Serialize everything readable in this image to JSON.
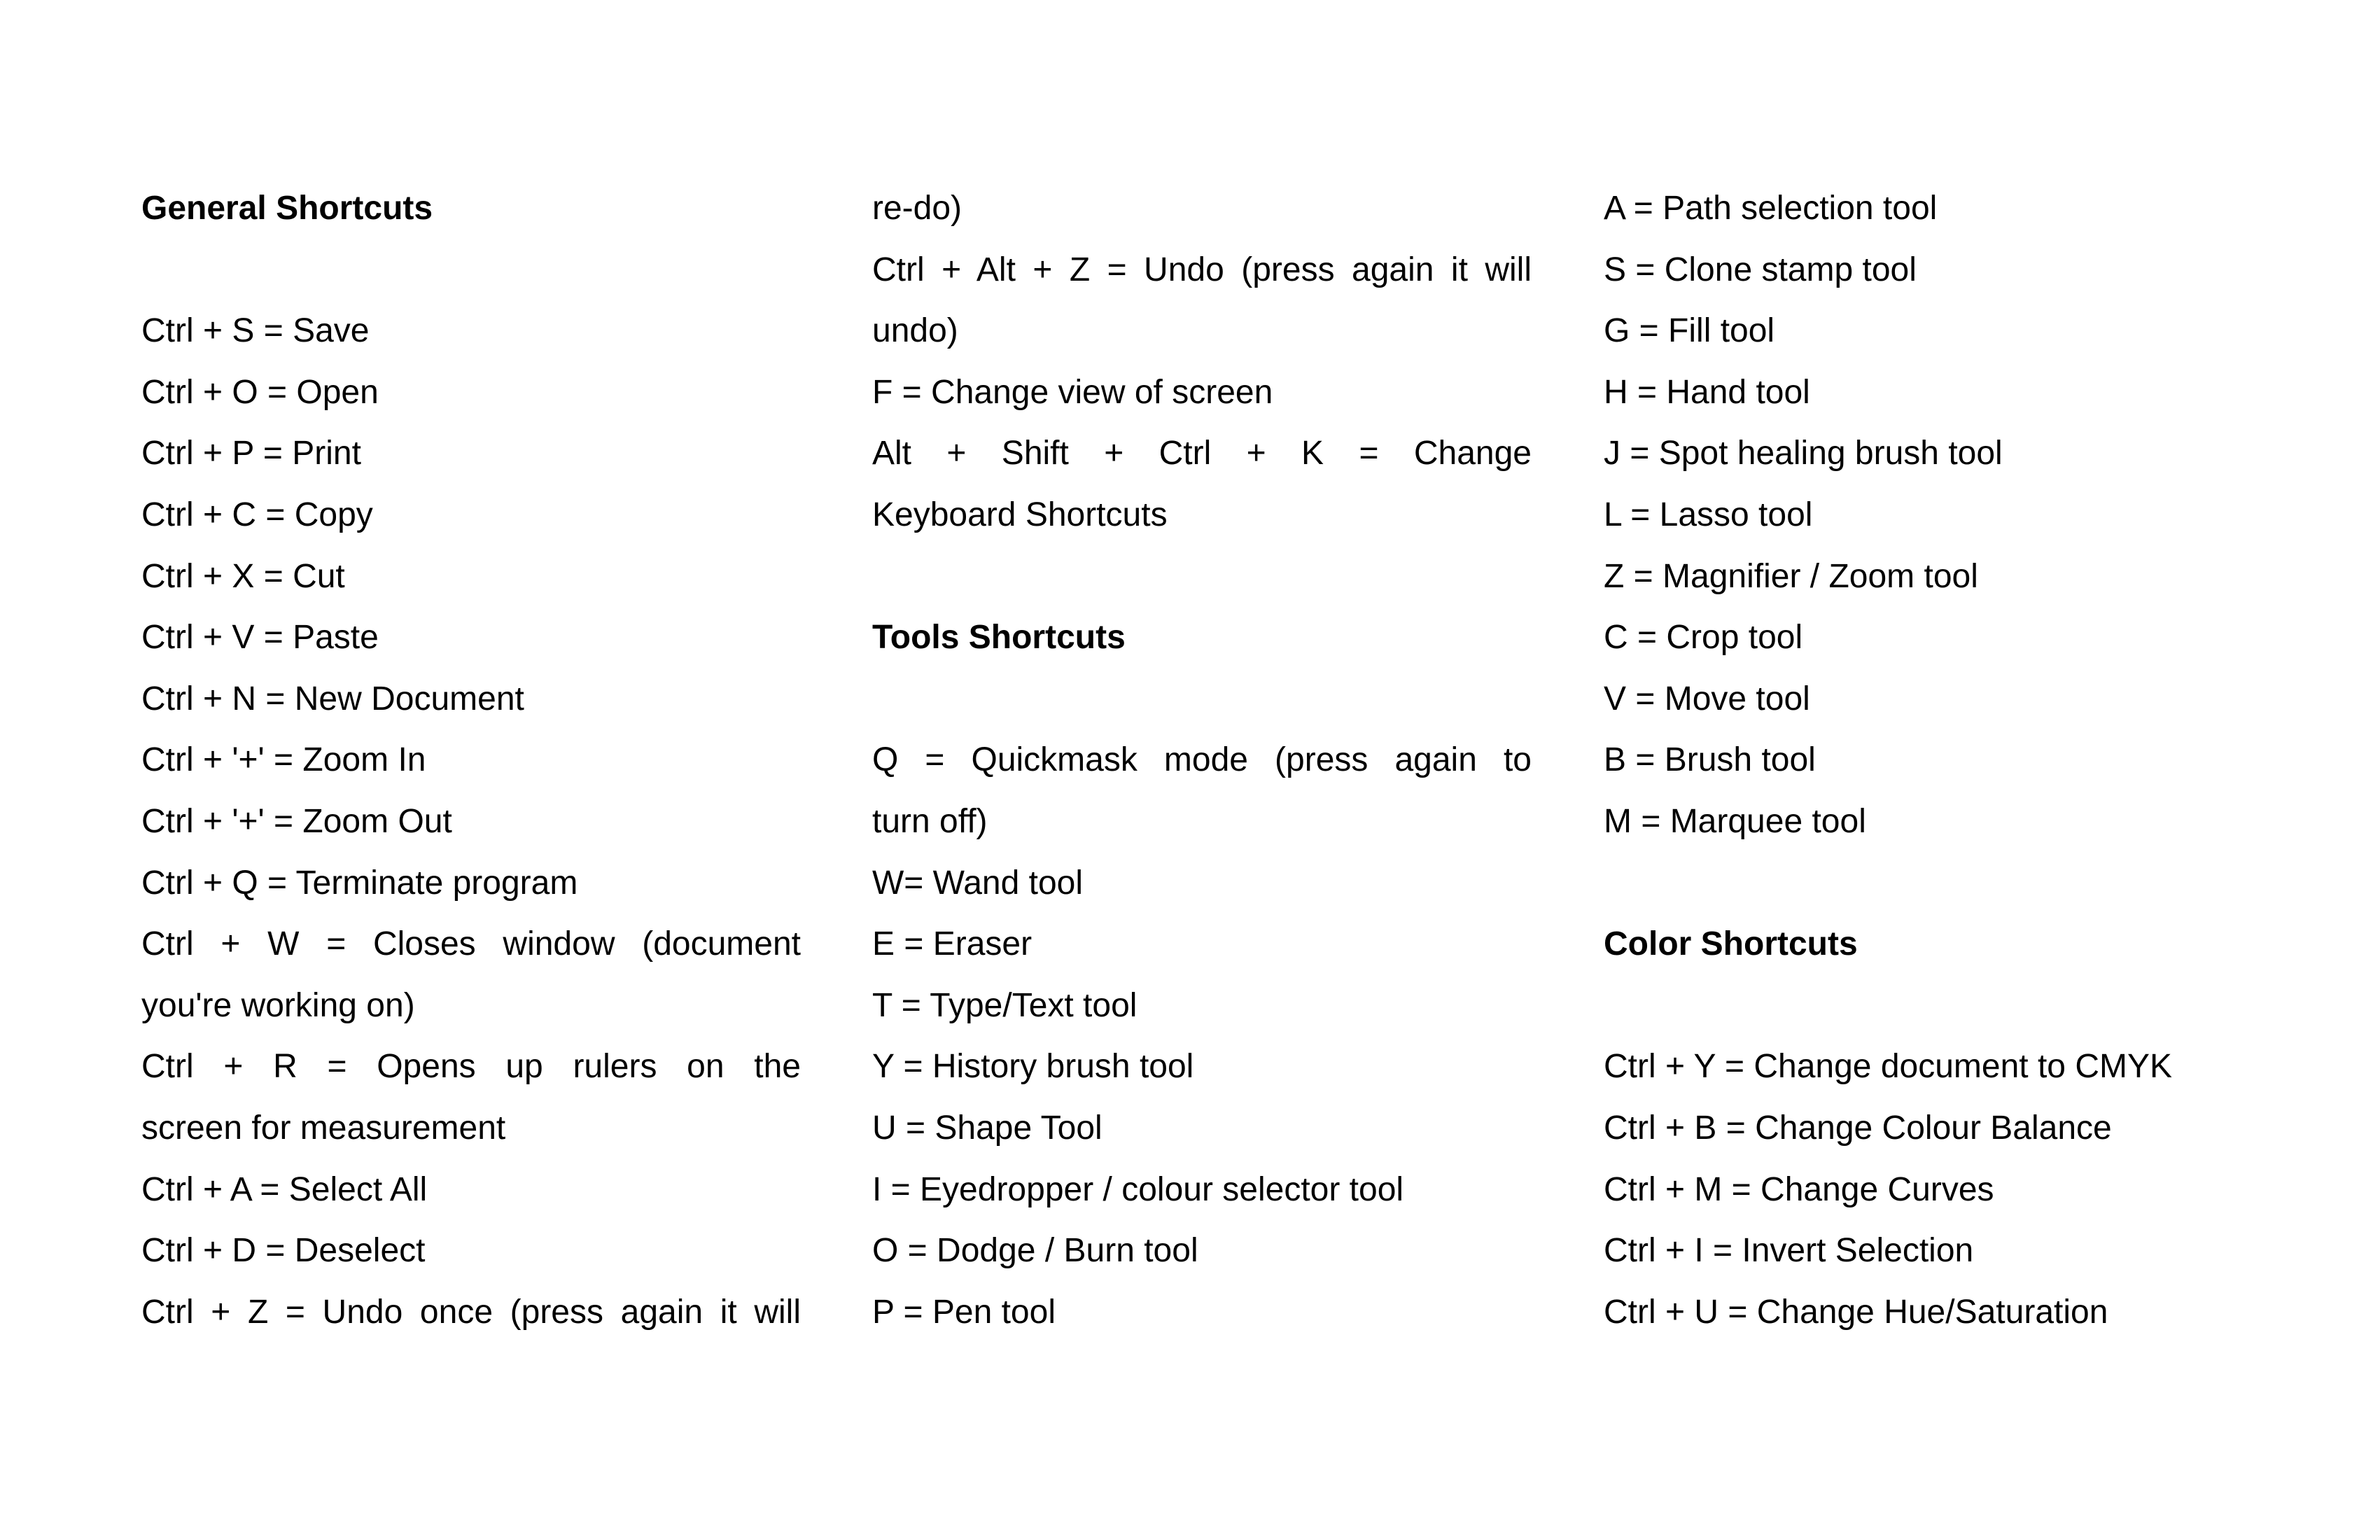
{
  "columns": [
    {
      "lines": [
        {
          "text": "General Shortcuts",
          "bold": true
        },
        {
          "text": ""
        },
        {
          "text": "Ctrl + S = Save"
        },
        {
          "text": "Ctrl + O = Open"
        },
        {
          "text": "Ctrl + P = Print"
        },
        {
          "text": "Ctrl + C = Copy"
        },
        {
          "text": "Ctrl + X = Cut"
        },
        {
          "text": "Ctrl + V = Paste"
        },
        {
          "text": "Ctrl + N = New Document"
        },
        {
          "text": "Ctrl + '+' = Zoom In"
        },
        {
          "text": "Ctrl + '+' = Zoom Out"
        },
        {
          "text": "Ctrl + Q = Terminate program"
        },
        {
          "text": "Ctrl + W = Closes window (document",
          "justify": true
        },
        {
          "text": "you're working on)"
        },
        {
          "text": "Ctrl + R = Opens up rulers on the",
          "justify": true
        },
        {
          "text": "screen for measurement"
        },
        {
          "text": "Ctrl + A = Select All"
        },
        {
          "text": "Ctrl + D = Deselect"
        },
        {
          "text": "Ctrl + Z = Undo once (press again it will",
          "justify": true
        }
      ]
    },
    {
      "lines": [
        {
          "text": "re-do)"
        },
        {
          "text": "Ctrl + Alt + Z = Undo (press again it will",
          "justify": true
        },
        {
          "text": "undo)"
        },
        {
          "text": "F = Change view of screen"
        },
        {
          "text": "Alt + Shift + Ctrl + K = Change",
          "justify": true
        },
        {
          "text": "Keyboard Shortcuts"
        },
        {
          "text": ""
        },
        {
          "text": "Tools Shortcuts",
          "bold": true
        },
        {
          "text": ""
        },
        {
          "text": "Q = Quickmask mode (press again to",
          "justify": true
        },
        {
          "text": "turn off)"
        },
        {
          "text": "W= Wand tool"
        },
        {
          "text": "E = Eraser"
        },
        {
          "text": "T = Type/Text tool"
        },
        {
          "text": "Y = History brush tool"
        },
        {
          "text": "U = Shape Tool"
        },
        {
          "text": "I = Eyedropper / colour selector tool"
        },
        {
          "text": "O = Dodge / Burn tool"
        },
        {
          "text": "P = Pen tool"
        }
      ]
    },
    {
      "lines": [
        {
          "text": "A = Path selection tool"
        },
        {
          "text": "S = Clone stamp tool"
        },
        {
          "text": "G = Fill tool"
        },
        {
          "text": "H = Hand tool"
        },
        {
          "text": "J = Spot healing brush tool"
        },
        {
          "text": "L = Lasso tool"
        },
        {
          "text": "Z = Magnifier / Zoom tool"
        },
        {
          "text": "C = Crop tool"
        },
        {
          "text": "V = Move tool"
        },
        {
          "text": "B = Brush tool"
        },
        {
          "text": "M = Marquee tool"
        },
        {
          "text": ""
        },
        {
          "text": "Color Shortcuts",
          "bold": true
        },
        {
          "text": ""
        },
        {
          "text": "Ctrl + Y = Change document to CMYK"
        },
        {
          "text": "Ctrl + B = Change Colour Balance"
        },
        {
          "text": "Ctrl + M = Change Curves"
        },
        {
          "text": "Ctrl + I = Invert Selection"
        },
        {
          "text": "Ctrl + U = Change Hue/Saturation"
        }
      ]
    }
  ]
}
